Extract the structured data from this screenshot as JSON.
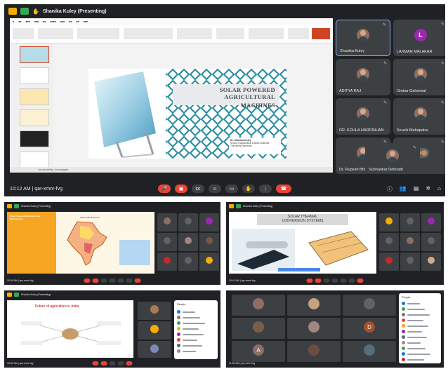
{
  "main": {
    "window_title": "Shanika Kuley (Presenting)",
    "time_meeting": "10:12 AM  |  qar-xmnr-fvg",
    "slide": {
      "title_line1": "SOLAR POWERED AGRICULTURAL",
      "title_line2": "MACHINES",
      "author_line1": "Dr. Shanika Kuley",
      "author_line2": "School of Agricultural & Allied Sciences",
      "author_line3": "The Neotia University"
    },
    "status_bar": "Accessibility: Investigate",
    "participants": [
      {
        "name": "Shanika Kuley",
        "type": "photo",
        "color": "#5f6368"
      },
      {
        "name": "LAXMAN MALAKAR",
        "type": "letter",
        "letter": "L",
        "color": "#9c27b0"
      },
      {
        "name": "ADITYA RAJ",
        "type": "photo",
        "color": "#5f6368"
      },
      {
        "name": "Omkar Gaherwal",
        "type": "photo",
        "color": "#5f6368"
      },
      {
        "name": "DR. KOHLA HARDINHAN",
        "type": "photo",
        "color": "#5f6368"
      },
      {
        "name": "Souvik Mahapatra",
        "type": "photo",
        "color": "#5f6368"
      },
      {
        "name": "Dr. Rupesh Bhikram Kal...",
        "type": "photo",
        "color": "#5f6368"
      },
      {
        "name": "12 others",
        "type": "group",
        "color": "#5f6368"
      },
      {
        "name": "Subhankar Debnath",
        "type": "photo",
        "color": "#5f6368"
      }
    ],
    "colors": {
      "bg": "#202124",
      "tile": "#3c4043",
      "end_call": "#ea4335",
      "slide_teal": "#2c8fa3"
    }
  },
  "thumbs": {
    "tl": {
      "window_title": "Shanika Kuley (Presenting)",
      "slide_title": "Solar Powered Machinery and Technologies",
      "slide_sub": "India Solar Resource",
      "time_meeting": "10:34 AM  |  qar-xmnr-fvg"
    },
    "tr": {
      "window_title": "Shanika Kuley (Presenting)",
      "slide_title_l1": "SOLAR THERMAL",
      "slide_title_l2": "CONVERSION SYSTEMS",
      "time_meeting": "10:41 AM  |  qar-xmnr-fvg"
    },
    "bl": {
      "window_title": "Shanika Kuley (Presenting)",
      "slide_title": "Future of agriculture in India",
      "people_title": "People",
      "time_meeting": "10:52 AM  |  qar-xmnr-fvg"
    },
    "br": {
      "people_title": "People",
      "time_meeting": "11:05 AM  |  qar-xmnr-fvg",
      "letters": [
        "A",
        "D"
      ]
    }
  }
}
